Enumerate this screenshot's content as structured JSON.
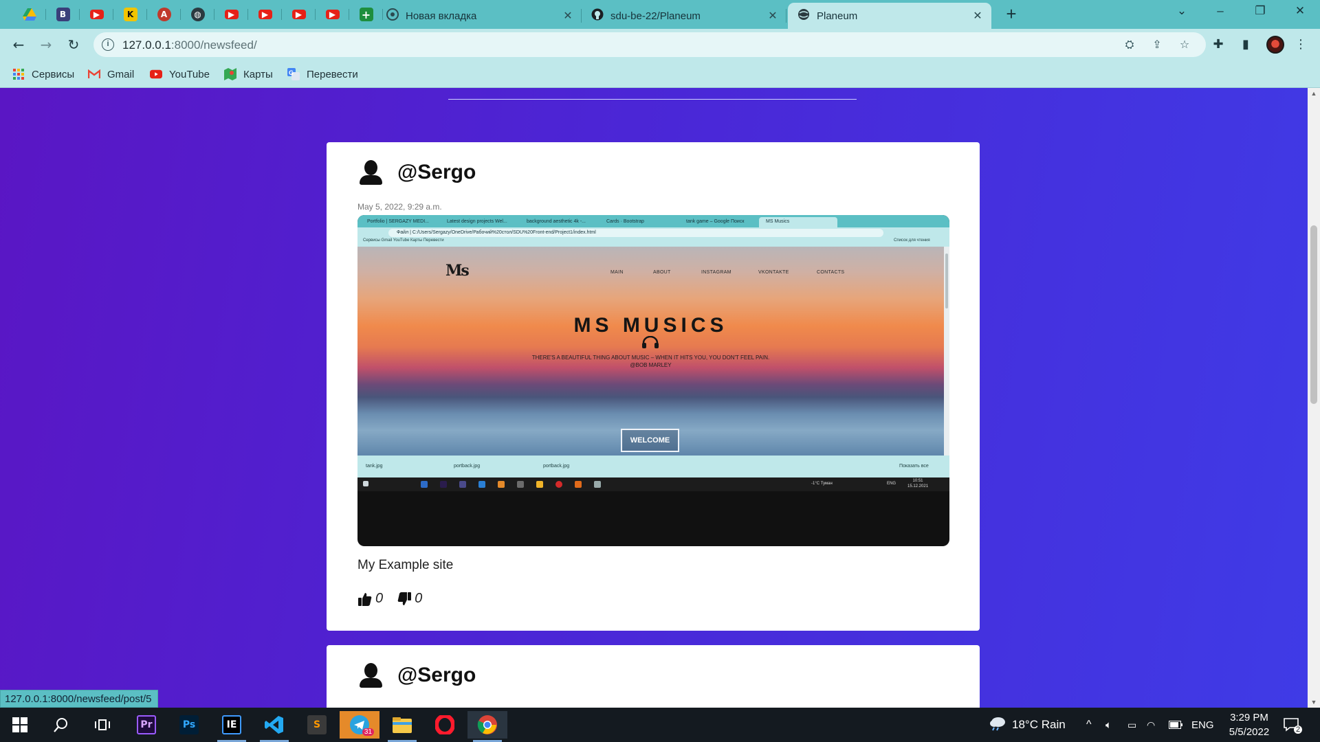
{
  "browser": {
    "pinned_tabs": [
      {
        "icon": "google-drive-icon",
        "color": "#4caf50"
      },
      {
        "icon": "b-letter-icon",
        "color": "#3a3f7a"
      },
      {
        "icon": "youtube-icon",
        "color": "#e62117"
      },
      {
        "icon": "k-letter-icon",
        "color": "#f2c400"
      },
      {
        "icon": "translate-app-icon",
        "color": "#c0392b"
      },
      {
        "icon": "globe-icon",
        "color": "#2b3a40"
      },
      {
        "icon": "youtube-icon",
        "color": "#e62117"
      },
      {
        "icon": "youtube-icon",
        "color": "#e62117"
      },
      {
        "icon": "youtube-icon",
        "color": "#e62117"
      },
      {
        "icon": "youtube-icon",
        "color": "#e62117"
      },
      {
        "icon": "sheets-plus-icon",
        "color": "#1e8e3e"
      }
    ],
    "tabs": [
      {
        "title": "Новая вкладка",
        "icon": "chrome-icon",
        "active": false
      },
      {
        "title": "sdu-be-22/Planeum",
        "icon": "github-icon",
        "active": false
      },
      {
        "title": "Planeum",
        "icon": "globe-icon",
        "active": true
      }
    ],
    "address": {
      "host": "127.0.0.1",
      "rest": ":8000/newsfeed/"
    },
    "bookmarks": [
      {
        "label": "Сервисы",
        "icon": "apps-grid-icon"
      },
      {
        "label": "Gmail",
        "icon": "gmail-icon"
      },
      {
        "label": "YouTube",
        "icon": "youtube-icon"
      },
      {
        "label": "Карты",
        "icon": "maps-icon"
      },
      {
        "label": "Перевести",
        "icon": "translate-icon"
      }
    ],
    "status_url": "127.0.0.1:8000/newsfeed/post/5",
    "colors": {
      "chrome": "#5bbfc4",
      "active_tab": "#bfe8ea"
    }
  },
  "feed": {
    "posts": [
      {
        "username": "@Sergo",
        "date": "May 5, 2022, 9:29 a.m.",
        "text": "My Example site",
        "likes": "0",
        "dislikes": "0"
      },
      {
        "username": "@Sergo"
      }
    ]
  },
  "post_image": {
    "tabs": [
      "Portfolio | SERGAZY MEDI...",
      "Latest design projects Wel...",
      "background aesthetic 4k -...",
      "Cards · Bootstrap",
      "tank game – Google Поиск",
      "MS Musics"
    ],
    "url": "Файл | C:/Users/Sergazy/OneDrive/Рабочий%20стол/SDU%20Front-end/Project1/index.html",
    "bookmarks": "Сервисы   Gmail   YouTube   Карты   Перевести",
    "reading_list": "Список для чтения",
    "logo": "Ms",
    "nav": [
      "MAIN",
      "ABOUT",
      "INSTAGRAM",
      "VKONTAKTE",
      "CONTACTS"
    ],
    "title": "MS MUSICS",
    "quote": "THERE'S A BEAUTIFUL THING ABOUT MUSIC – WHEN IT HITS YOU, YOU DON'T FEEL PAIN.",
    "author": "@BOB MARLEY",
    "button": "WELCOME",
    "downloads": [
      "tank.jpg",
      "portback.jpg",
      "portback.jpg"
    ],
    "show_all": "Показать все",
    "tray": "-1°C  Туман",
    "lang": "ENG",
    "time": "10:51",
    "date": "15.12.2021"
  },
  "taskbar": {
    "apps": [
      {
        "icon": "windows-start-icon"
      },
      {
        "icon": "search-icon"
      },
      {
        "icon": "task-view-icon"
      },
      {
        "icon": "premiere-pro-icon",
        "label": "Pr"
      },
      {
        "icon": "photoshop-icon",
        "label": "Ps"
      },
      {
        "icon": "intellij-icon",
        "label": "IE"
      },
      {
        "icon": "vscode-icon"
      },
      {
        "icon": "sublime-text-icon"
      },
      {
        "icon": "telegram-icon",
        "badge": "31"
      },
      {
        "icon": "file-explorer-icon"
      },
      {
        "icon": "opera-icon"
      },
      {
        "icon": "chrome-icon"
      }
    ],
    "weather": "18°C  Rain",
    "language": "ENG",
    "time": "3:29 PM",
    "date": "5/5/2022",
    "notifications": "2"
  }
}
